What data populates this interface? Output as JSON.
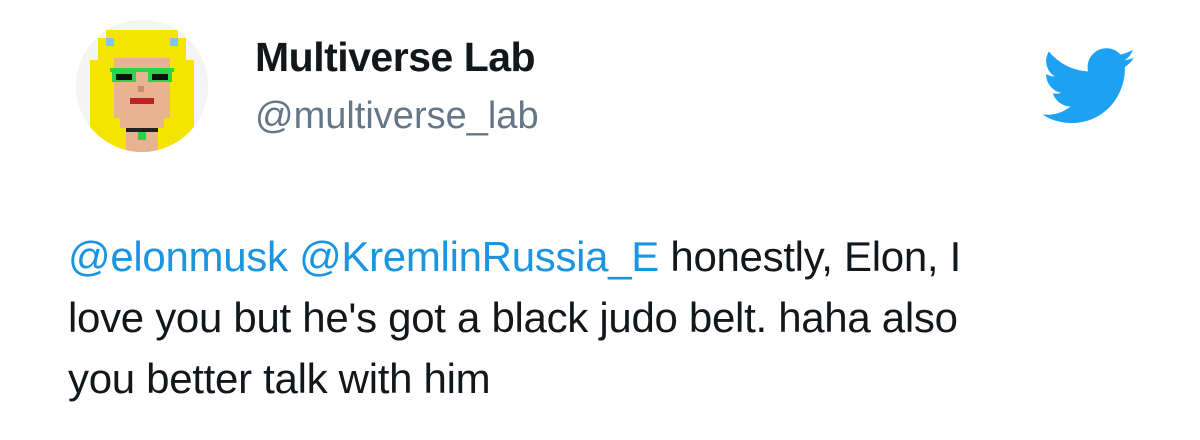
{
  "user": {
    "display_name": "Multiverse Lab",
    "handle": "@multiverse_lab",
    "avatar_icon": "pixel-art-blonde-avatar-icon"
  },
  "brand": {
    "icon": "twitter-bird-icon",
    "color": "#1da1f2"
  },
  "tweet": {
    "mentions": [
      "@elonmusk",
      "@KremlinRussia_E"
    ],
    "text_line1_rest": " honestly, Elon, I",
    "text_line2": "love you but he's got a black judo belt. haha also",
    "text_line3": "you better talk with him"
  },
  "colors": {
    "mention": "#1b95e0",
    "handle": "#657786",
    "text": "#14171a"
  }
}
